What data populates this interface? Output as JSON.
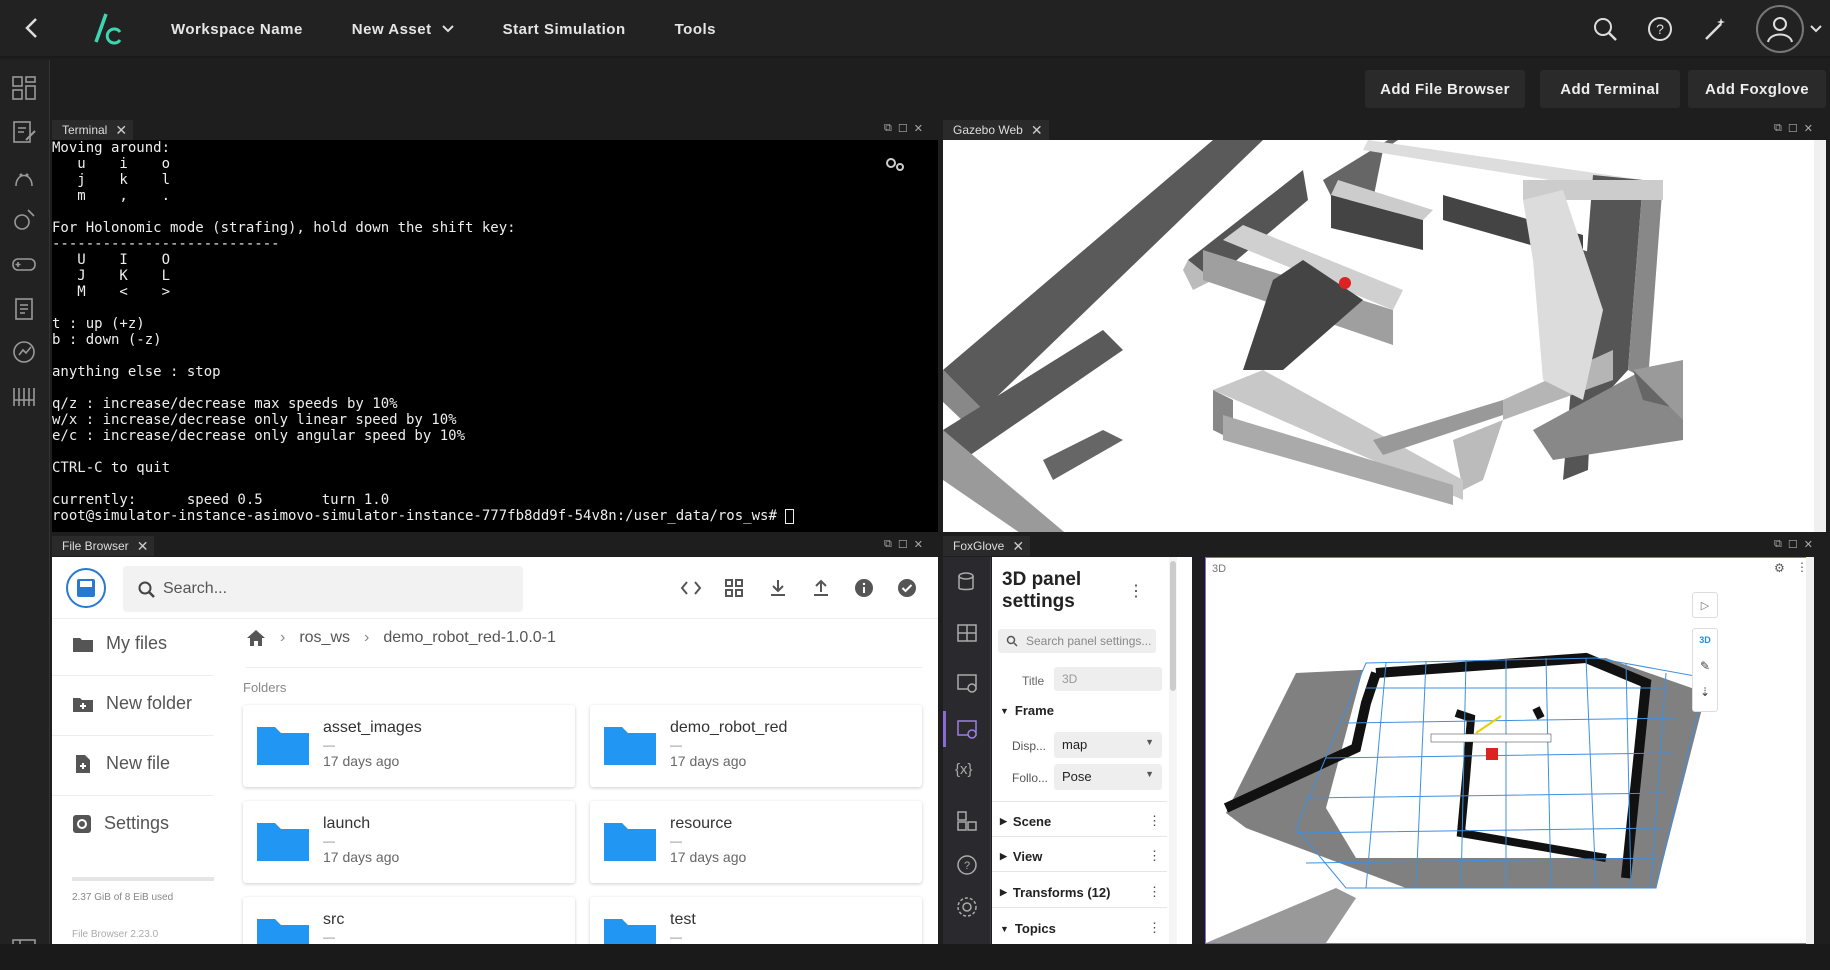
{
  "topbar": {
    "workspace": "Workspace Name",
    "new_asset": "New Asset",
    "start_sim": "Start Simulation",
    "tools": "Tools"
  },
  "toolbar": {
    "add_file_browser": "Add File Browser",
    "add_terminal": "Add Terminal",
    "add_foxglove": "Add Foxglove"
  },
  "panels": {
    "terminal": "Terminal",
    "gazebo": "Gazebo Web",
    "file_browser": "File Browser",
    "foxglove": "FoxGlove"
  },
  "terminal_lines": [
    "Moving around:",
    "   u    i    o",
    "   j    k    l",
    "   m    ,    .",
    "",
    "For Holonomic mode (strafing), hold down the shift key:",
    "---------------------------",
    "   U    I    O",
    "   J    K    L",
    "   M    <    >",
    "",
    "t : up (+z)",
    "b : down (-z)",
    "",
    "anything else : stop",
    "",
    "q/z : increase/decrease max speeds by 10%",
    "w/x : increase/decrease only linear speed by 10%",
    "e/c : increase/decrease only angular speed by 10%",
    "",
    "CTRL-C to quit",
    "",
    "currently:      speed 0.5       turn 1.0",
    "root@simulator-instance-asimovo-simulator-instance-777fb8dd9f-54v8n:/user_data/ros_ws# "
  ],
  "file_browser": {
    "search_placeholder": "Search...",
    "my_files": "My files",
    "new_folder": "New folder",
    "new_file": "New file",
    "settings": "Settings",
    "usage": "2.37 GiB of 8 EiB used",
    "version": "File Browser 2.23.0",
    "crumb1": "ros_ws",
    "crumb2": "demo_robot_red-1.0.0-1",
    "folders_label": "Folders",
    "folders": [
      {
        "name": "asset_images",
        "dash": "—",
        "date": "17 days ago"
      },
      {
        "name": "demo_robot_red",
        "dash": "—",
        "date": "17 days ago"
      },
      {
        "name": "launch",
        "dash": "—",
        "date": "17 days ago"
      },
      {
        "name": "resource",
        "dash": "—",
        "date": "17 days ago"
      },
      {
        "name": "src",
        "dash": "—",
        "date": ""
      },
      {
        "name": "test",
        "dash": "—",
        "date": ""
      }
    ]
  },
  "foxglove": {
    "settings_title_1": "3D panel",
    "settings_title_2": "settings",
    "search_placeholder": "Search panel settings...",
    "title_label": "Title",
    "title_value": "3D",
    "frame": "Frame",
    "display_label": "Disp...",
    "display_value": "map",
    "follow_label": "Follo...",
    "follow_value": "Pose",
    "scene": "Scene",
    "view": "View",
    "transforms": "Transforms (12)",
    "topics": "Topics",
    "view_label": "3D",
    "btn_3d": "3D"
  }
}
